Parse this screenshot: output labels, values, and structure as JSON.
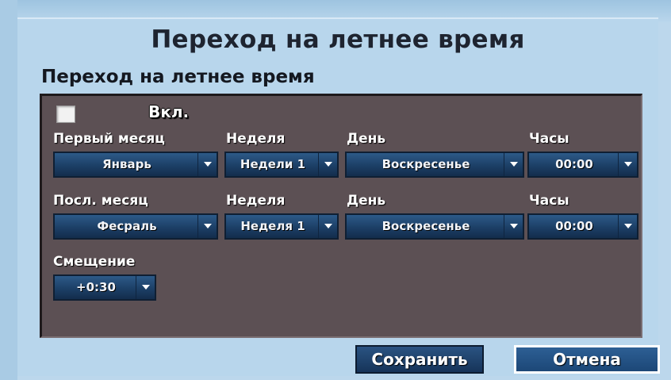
{
  "dialog": {
    "title": "Переход на летнее время",
    "section_title": "Переход на летнее время"
  },
  "enable": {
    "label": "Вкл.",
    "checked": false
  },
  "start": {
    "month_label": "Первый месяц",
    "month_value": "Январь",
    "week_label": "Неделя",
    "week_value": "Недели 1",
    "day_label": "День",
    "day_value": "Воскресенье",
    "hour_label": "Часы",
    "hour_value": "00:00"
  },
  "end": {
    "month_label": "Посл. месяц",
    "month_value": "Феcраль",
    "week_label": "Неделя",
    "week_value": "Неделя 1",
    "day_label": "День",
    "day_value": "Воскресенье",
    "hour_label": "Часы",
    "hour_value": "00:00"
  },
  "offset": {
    "label": "Смещение",
    "value": "+0:30"
  },
  "buttons": {
    "save": "Сохранить",
    "cancel": "Отмена"
  },
  "colors": {
    "panel": "#5c5054",
    "dropdown": "#1c3f66",
    "background": "#b8d6ec"
  }
}
